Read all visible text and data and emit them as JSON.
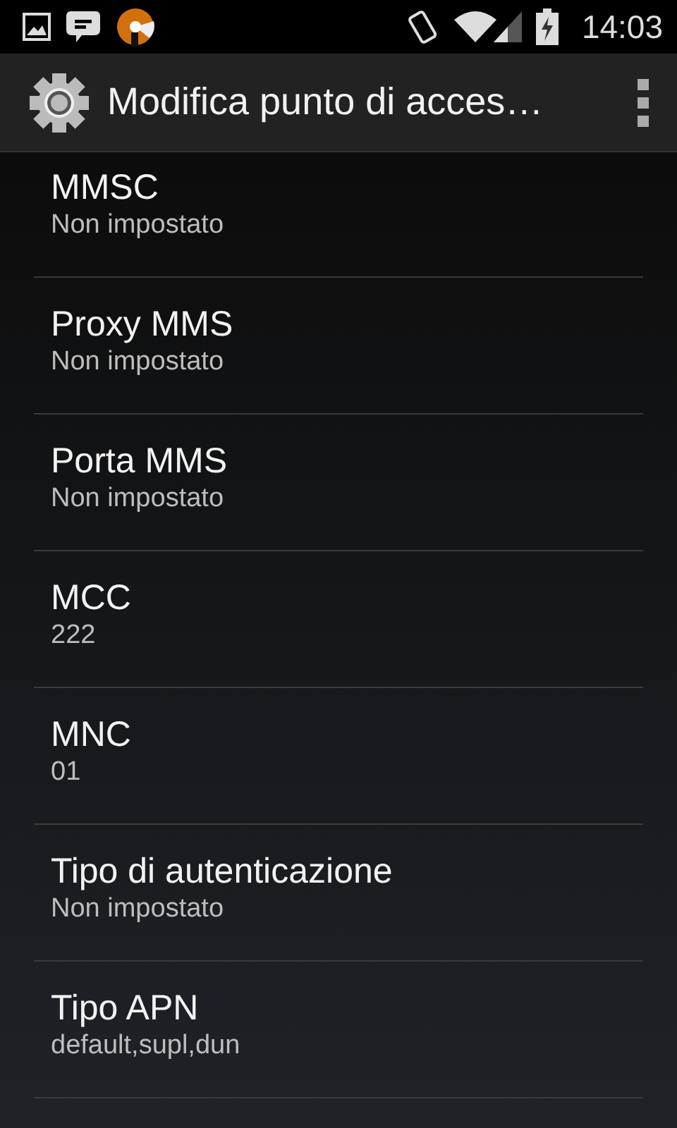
{
  "status_bar": {
    "time": "14:03"
  },
  "action_bar": {
    "title": "Modifica punto di acces…"
  },
  "settings": [
    {
      "title": "MMSC",
      "summary": "Non impostato"
    },
    {
      "title": "Proxy MMS",
      "summary": "Non impostato"
    },
    {
      "title": "Porta MMS",
      "summary": "Non impostato"
    },
    {
      "title": "MCC",
      "summary": "222"
    },
    {
      "title": "MNC",
      "summary": "01"
    },
    {
      "title": "Tipo di autenticazione",
      "summary": "Non impostato"
    },
    {
      "title": "Tipo APN",
      "summary": "default,supl,dun"
    }
  ]
}
